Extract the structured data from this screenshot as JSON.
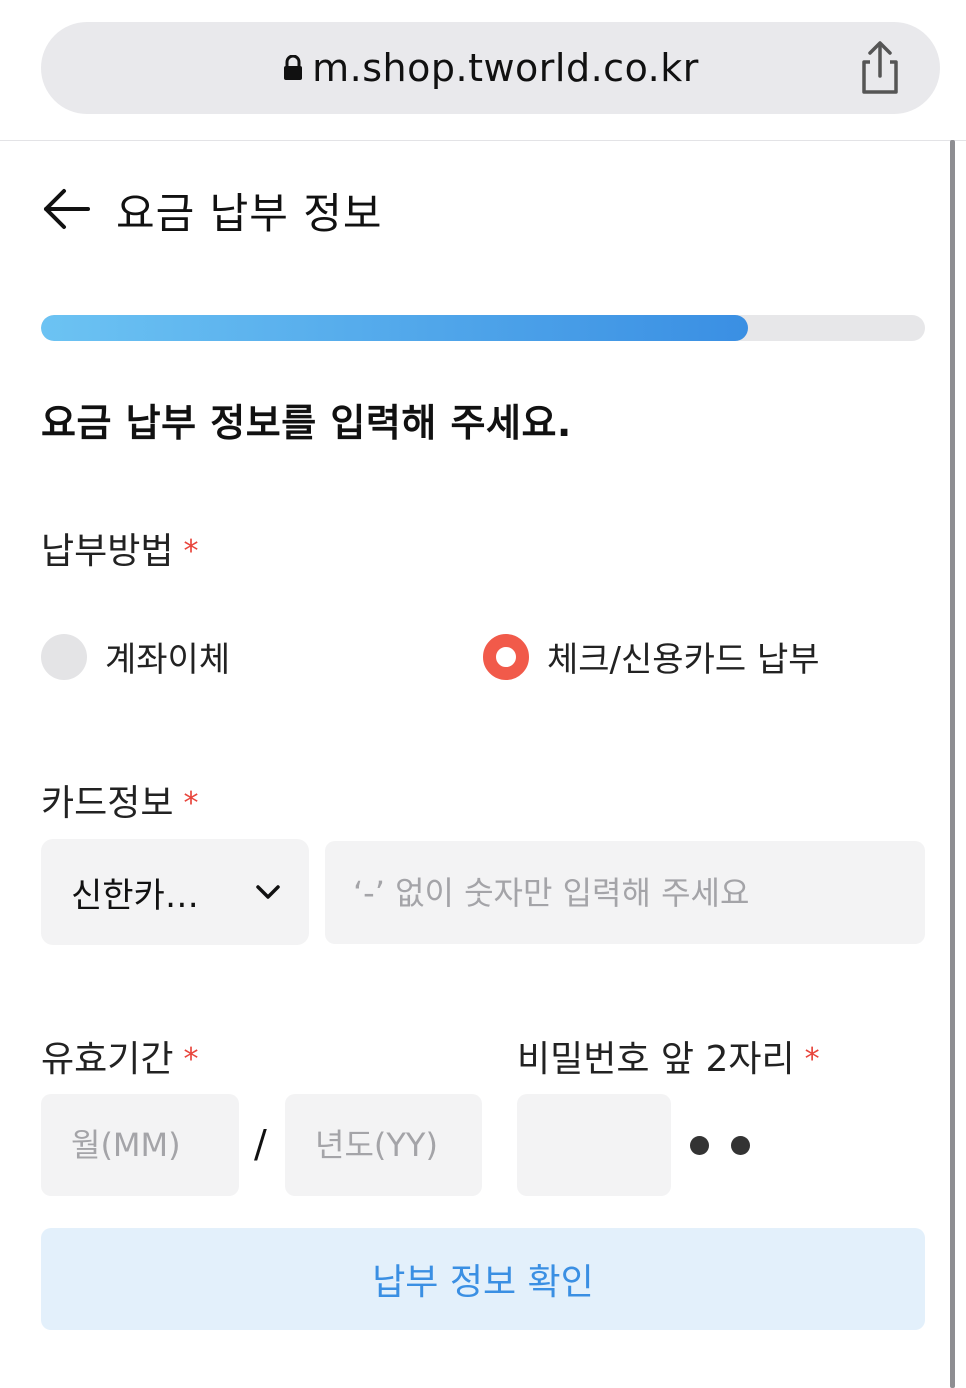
{
  "browser": {
    "url": "m.shop.tworld.co.kr"
  },
  "header": {
    "title": "요금 납부 정보"
  },
  "progress": {
    "fraction": 0.8
  },
  "main": {
    "heading": "요금 납부 정보를 입력해 주세요.",
    "payment_method": {
      "label": "납부방법",
      "required_mark": "*",
      "options": [
        {
          "label": "계좌이체",
          "selected": false
        },
        {
          "label": "체크/신용카드 납부",
          "selected": true
        }
      ]
    },
    "card_info": {
      "label": "카드정보",
      "required_mark": "*",
      "card_company": "신한카…",
      "number_placeholder": "‘-’ 없이 숫자만 입력해 주세요"
    },
    "expiry": {
      "label": "유효기간",
      "required_mark": "*",
      "month_placeholder": "월(MM)",
      "separator": "/",
      "year_placeholder": "년도(YY)"
    },
    "password": {
      "label": "비밀번호 앞 2자리",
      "required_mark": "*"
    },
    "confirm_button": "납부 정보 확인"
  },
  "colors": {
    "accent_blue": "#3a8fe3",
    "required_red": "#e8453c",
    "radio_selected": "#f15a4a"
  }
}
